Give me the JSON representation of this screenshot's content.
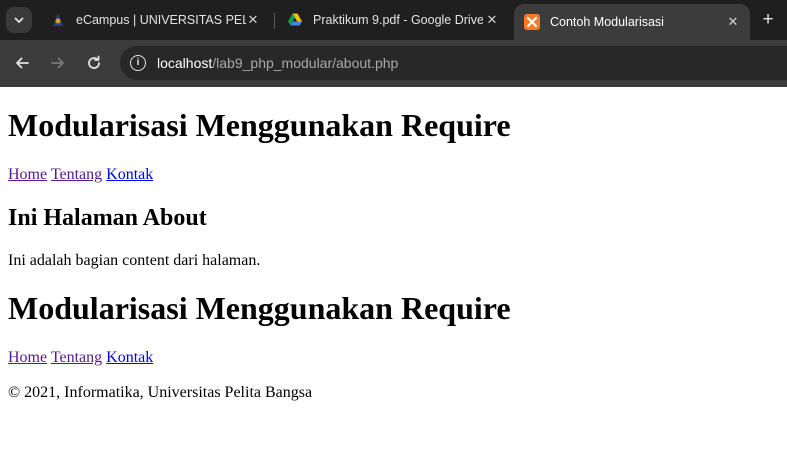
{
  "browser": {
    "tabs": [
      {
        "title": "eCampus | UNIVERSITAS PELITA BANGSA",
        "favicon": "ecampus-icon",
        "active": false
      },
      {
        "title": "Praktikum 9.pdf - Google Drive",
        "favicon": "google-drive-icon",
        "active": false
      },
      {
        "title": "Contoh Modularisasi",
        "favicon": "xampp-icon",
        "active": true
      }
    ],
    "close_glyph": "✕",
    "new_tab_glyph": "+",
    "url_host": "localhost",
    "url_path": "/lab9_php_modular/about.php",
    "colors": {
      "frame": "#1f1f1f",
      "toolbar": "#3c3c3c",
      "omnibox": "#282828",
      "xampp": "#fb7a24"
    }
  },
  "page": {
    "header_title": "Modularisasi Menggunakan Require",
    "nav": {
      "home": "Home",
      "about": "Tentang",
      "contact": "Kontak"
    },
    "content_heading": "Ini Halaman About",
    "content_text": "Ini adalah bagian content dari halaman.",
    "footer_title": "Modularisasi Menggunakan Require",
    "footer_nav": {
      "home": "Home",
      "about": "Tentang",
      "contact": "Kontak"
    },
    "copyright": "© 2021, Informatika, Universitas Pelita Bangsa"
  }
}
